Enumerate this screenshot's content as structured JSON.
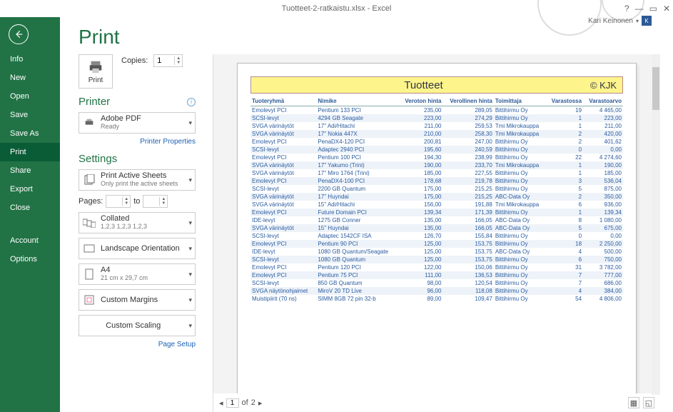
{
  "window": {
    "title": "Tuotteet-2-ratkaistu.xlsx - Excel",
    "user": "Kari Keinonen"
  },
  "sidebar": {
    "items": [
      {
        "label": "Info"
      },
      {
        "label": "New"
      },
      {
        "label": "Open"
      },
      {
        "label": "Save"
      },
      {
        "label": "Save As"
      },
      {
        "label": "Print"
      },
      {
        "label": "Share"
      },
      {
        "label": "Export"
      },
      {
        "label": "Close"
      }
    ],
    "bottom": [
      {
        "label": "Account"
      },
      {
        "label": "Options"
      }
    ]
  },
  "print": {
    "heading": "Print",
    "button_label": "Print",
    "copies_label": "Copies:",
    "copies_value": "1",
    "printer_heading": "Printer",
    "printer_name": "Adobe PDF",
    "printer_status": "Ready",
    "printer_props": "Printer Properties",
    "settings_heading": "Settings",
    "sheets_main": "Print Active Sheets",
    "sheets_sub": "Only print the active sheets",
    "pages_label": "Pages:",
    "pages_to": "to",
    "pages_from": "",
    "pages_to_val": "",
    "collate_main": "Collated",
    "collate_sub": "1,2,3   1,2,3   1,2,3",
    "orient": "Landscape Orientation",
    "size_main": "A4",
    "size_sub": "21 cm x 29,7 cm",
    "margins": "Custom Margins",
    "scaling": "Custom Scaling",
    "page_setup": "Page Setup"
  },
  "preview": {
    "current": "1",
    "of_label": "of",
    "total": "2",
    "title": "Tuotteet",
    "copyright": "© KJK",
    "cols": [
      "Tuoteryhmä",
      "Nimike",
      "Veroton hinta",
      "Verollinen hinta",
      "Toimittaja",
      "Varastossa",
      "Varastoarvo"
    ],
    "rows": [
      [
        "Emolevyt PCI",
        "Pentium 133 PCI",
        "235,00",
        "289,05",
        "Bittihirmu Oy",
        "19",
        "4 465,00"
      ],
      [
        "SCSI-levyt",
        "4294 GB Seagate",
        "223,00",
        "274,29",
        "Bittihirmu Oy",
        "1",
        "223,00"
      ],
      [
        "SVGA värinäytöt",
        "17\" Adi/Hitachi",
        "211,00",
        "259,53",
        "Tmi Mikrokauppa",
        "1",
        "211,00"
      ],
      [
        "SVGA värinäytöt",
        "17\" Nokia 447X",
        "210,00",
        "258,30",
        "Tmi Mikrokauppa",
        "2",
        "420,00"
      ],
      [
        "Emolevyt PCI",
        "PenaDX4-120 PCI",
        "200,81",
        "247,00",
        "Bittihirmu Oy",
        "2",
        "401,62"
      ],
      [
        "SCSI-levyt",
        "Adaptec 2940 PCI",
        "195,60",
        "240,59",
        "Bittihirmu Oy",
        "0",
        "0,00"
      ],
      [
        "Emolevyt PCI",
        "Pentium 100 PCI",
        "194,30",
        "238,99",
        "Bittihirmu Oy",
        "22",
        "4 274,60"
      ],
      [
        "SVGA värinäytöt",
        "17\" Yakumo (Trini)",
        "190,00",
        "233,70",
        "Tmi Mikrokauppa",
        "1",
        "190,00"
      ],
      [
        "SVGA värinäytöt",
        "17\" Miro 1764 (Trini)",
        "185,00",
        "227,55",
        "Bittihirmu Oy",
        "1",
        "185,00"
      ],
      [
        "Emolevyt PCI",
        "PenaDX4-100 PCI",
        "178,68",
        "219,78",
        "Bittihirmu Oy",
        "3",
        "536,04"
      ],
      [
        "SCSI-levyt",
        "2200 GB Quantum",
        "175,00",
        "215,25",
        "Bittihirmu Oy",
        "5",
        "875,00"
      ],
      [
        "SVGA värinäytöt",
        "17\" Huyndai",
        "175,00",
        "215,25",
        "ABC-Data Oy",
        "2",
        "350,00"
      ],
      [
        "SVGA värinäytöt",
        "15\" Adi/Hitachi",
        "156,00",
        "191,88",
        "Tmi Mikrokauppa",
        "6",
        "936,00"
      ],
      [
        "Emolevyt PCI",
        "Future Domain PCI",
        "139,34",
        "171,39",
        "Bittihirmu Oy",
        "1",
        "139,34"
      ],
      [
        "IDE-levyt",
        "1275 GB Conner",
        "135,00",
        "166,05",
        "ABC-Data Oy",
        "8",
        "1 080,00"
      ],
      [
        "SVGA värinäytöt",
        "15\" Huyndai",
        "135,00",
        "166,05",
        "ABC-Data Oy",
        "5",
        "675,00"
      ],
      [
        "SCSI-levyt",
        "Adaptec 1542CF ISA",
        "126,70",
        "155,84",
        "Bittihirmu Oy",
        "0",
        "0,00"
      ],
      [
        "Emolevyt PCI",
        "Pentium 90 PCI",
        "125,00",
        "153,75",
        "Bittihirmu Oy",
        "18",
        "2 250,00"
      ],
      [
        "IDE-levyt",
        "1080 GB Quantum/Seagate",
        "125,00",
        "153,75",
        "ABC-Data Oy",
        "4",
        "500,00"
      ],
      [
        "SCSI-levyt",
        "1080 GB Quantum",
        "125,00",
        "153,75",
        "Bittihirmu Oy",
        "6",
        "750,00"
      ],
      [
        "Emolevyt PCI",
        "Pentium 120 PCI",
        "122,00",
        "150,06",
        "Bittihirmu Oy",
        "31",
        "3 782,00"
      ],
      [
        "Emolevyt PCI",
        "Pentium 75 PCI",
        "111,00",
        "136,53",
        "Bittihirmu Oy",
        "7",
        "777,00"
      ],
      [
        "SCSI-levyt",
        "850 GB Quantum",
        "98,00",
        "120,54",
        "Bittihirmu Oy",
        "7",
        "686,00"
      ],
      [
        "SVGA näytönohjaimet",
        "MiroV 20 TD Live",
        "96,00",
        "118,08",
        "Bittihirmu Oy",
        "4",
        "384,00"
      ],
      [
        "Muistipiirit (70 ns)",
        "SIMM 8GB 72 pin 32-b",
        "89,00",
        "109,47",
        "Bittihirmu Oy",
        "54",
        "4 806,00"
      ]
    ]
  }
}
